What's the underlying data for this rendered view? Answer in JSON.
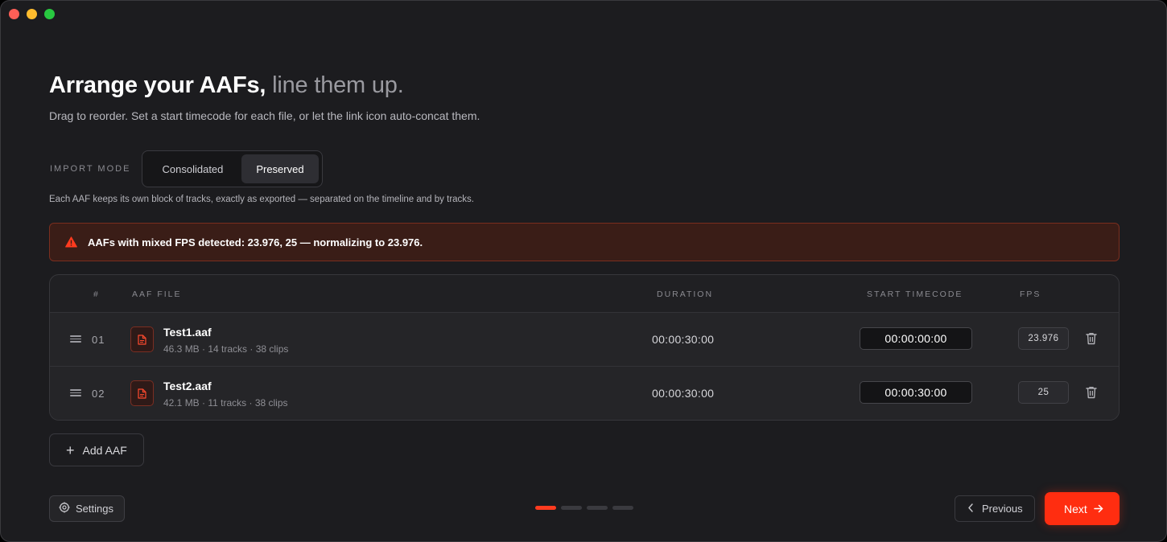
{
  "header": {
    "title_main": "Arrange your AAFs,",
    "title_muted": "line them up.",
    "subtitle": "Drag to reorder. Set a start timecode for each file, or let the link icon auto-concat them."
  },
  "import_mode": {
    "label": "IMPORT MODE",
    "options": [
      "Consolidated",
      "Preserved"
    ],
    "selected": "Preserved",
    "description": "Each AAF keeps its own block of tracks, exactly as exported — separated on the timeline and by tracks."
  },
  "alert": {
    "icon": "warning-triangle-icon",
    "text": "AAFs with mixed FPS detected: 23.976, 25 — normalizing to 23.976."
  },
  "table": {
    "headers": {
      "index": "#",
      "file": "AAF FILE",
      "duration": "DURATION",
      "start_timecode": "START TIMECODE",
      "fps": "FPS"
    },
    "rows": [
      {
        "index": "01",
        "name": "Test1.aaf",
        "meta": "46.3 MB · 14 tracks · 38 clips",
        "duration": "00:00:30:00",
        "start_timecode": "00:00:00:00",
        "fps": "23.976"
      },
      {
        "index": "02",
        "name": "Test2.aaf",
        "meta": "42.1 MB · 11 tracks · 38 clips",
        "duration": "00:00:30:00",
        "start_timecode": "00:00:30:00",
        "fps": "25"
      }
    ]
  },
  "actions": {
    "add_aaf": "Add AAF",
    "settings": "Settings",
    "previous": "Previous",
    "next": "Next"
  },
  "stepper": {
    "total_steps": 4,
    "current_step": 1
  },
  "colors": {
    "accent": "#ff2d10",
    "background": "#1c1c1f",
    "alert_bg": "#3a1d17",
    "alert_border": "#7a2e1f",
    "warning_icon": "#ff3b1f"
  }
}
